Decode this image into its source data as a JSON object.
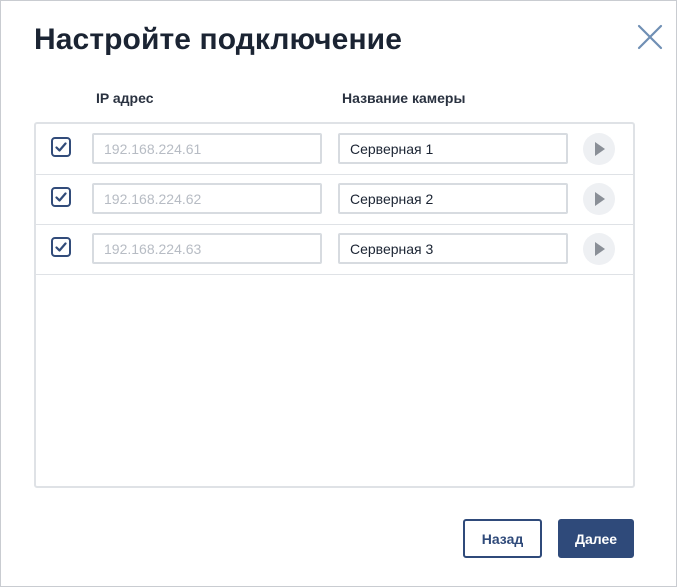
{
  "dialog": {
    "title": "Настройте подключение",
    "close_icon": "close-icon"
  },
  "columns": {
    "ip": "IP адрес",
    "name": "Название камеры"
  },
  "rows": [
    {
      "checked": true,
      "ip_placeholder": "192.168.224.61",
      "name": "Серверная 1"
    },
    {
      "checked": true,
      "ip_placeholder": "192.168.224.62",
      "name": "Серверная 2"
    },
    {
      "checked": true,
      "ip_placeholder": "192.168.224.63",
      "name": "Серверная 3"
    }
  ],
  "buttons": {
    "back": "Назад",
    "next": "Далее"
  },
  "colors": {
    "accent": "#2f4a7a",
    "title": "#1b2433",
    "border": "#dfe2e6",
    "placeholder": "#b7bcc4"
  }
}
